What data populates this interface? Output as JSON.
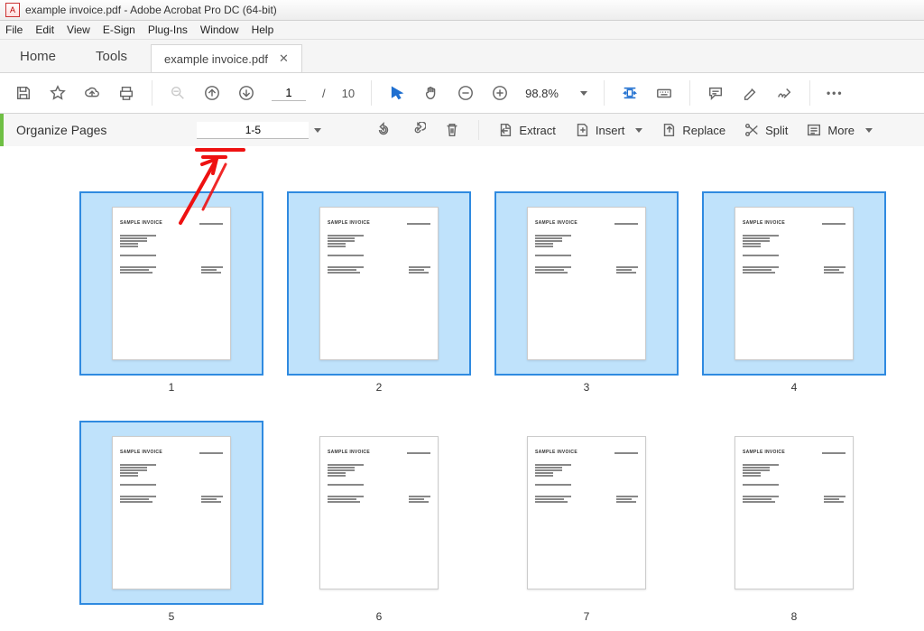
{
  "window": {
    "title": "example invoice.pdf - Adobe Acrobat Pro DC (64-bit)"
  },
  "menubar": {
    "items": [
      "File",
      "Edit",
      "View",
      "E-Sign",
      "Plug-Ins",
      "Window",
      "Help"
    ]
  },
  "tabs": {
    "home": "Home",
    "tools": "Tools",
    "doc": "example invoice.pdf"
  },
  "toolbar": {
    "current_page": "1",
    "page_sep": "/",
    "total_pages": "10",
    "zoom_value": "98.8%"
  },
  "organize": {
    "title": "Organize Pages",
    "range": "1-5",
    "extract": "Extract",
    "insert": "Insert",
    "replace": "Replace",
    "split": "Split",
    "more": "More"
  },
  "pages": [
    {
      "number": "1",
      "title": "SAMPLE INVOICE",
      "selected": true
    },
    {
      "number": "2",
      "title": "SAMPLE INVOICE",
      "selected": true
    },
    {
      "number": "3",
      "title": "SAMPLE INVOICE",
      "selected": true
    },
    {
      "number": "4",
      "title": "SAMPLE INVOICE",
      "selected": true
    },
    {
      "number": "5",
      "title": "SAMPLE INVOICE",
      "selected": true
    },
    {
      "number": "6",
      "title": "SAMPLE INVOICE",
      "selected": false
    },
    {
      "number": "7",
      "title": "SAMPLE INVOICE",
      "selected": false
    },
    {
      "number": "8",
      "title": "SAMPLE INVOICE",
      "selected": false
    }
  ]
}
